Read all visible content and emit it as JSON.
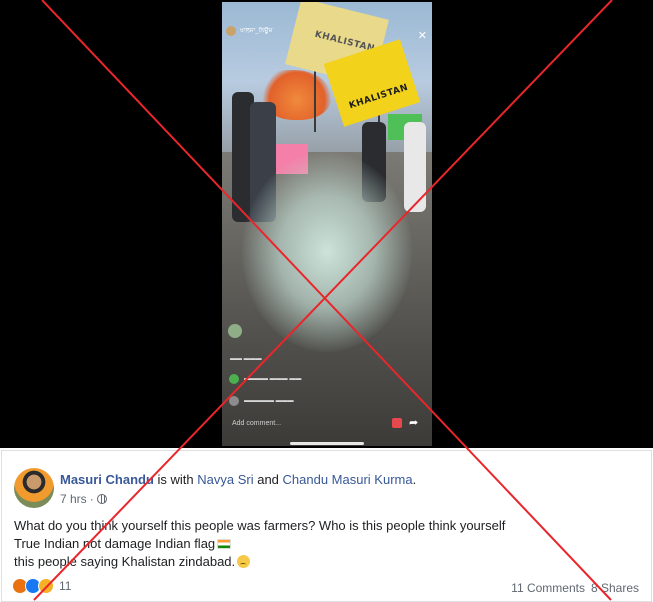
{
  "video": {
    "stream_name": "ਖਾਲਸਾ_ਨਿਊਜ਼",
    "flag_texts": [
      "KHALISTAN",
      "KHALISTAN"
    ],
    "add_comment_placeholder": "Add comment..."
  },
  "post": {
    "author": "Masuri Chandu",
    "with_text": " is with ",
    "tagged_1": "Navya Sri",
    "and_text": " and ",
    "tagged_2": "Chandu Masuri Kurma",
    "period": ".",
    "time": "7 hrs",
    "separator": "·",
    "lines": [
      "What do you think yourself this people was farmers? Who is this people think yourself",
      "True Indian not damage Indian flag",
      "this people saying Khalistan zindabad."
    ],
    "reaction_count": "11",
    "comments": "11 Comments",
    "shares": "8 Shares"
  },
  "colors": {
    "cross": "#e8262c",
    "link": "#385898",
    "meta": "#606770",
    "flag_yellow": "#f2d21b"
  },
  "icons": [
    "globe-icon",
    "close-icon",
    "share-icon",
    "angry-reaction-icon",
    "like-reaction-icon",
    "haha-reaction-icon",
    "india-flag-emoji",
    "sad-emoji"
  ]
}
